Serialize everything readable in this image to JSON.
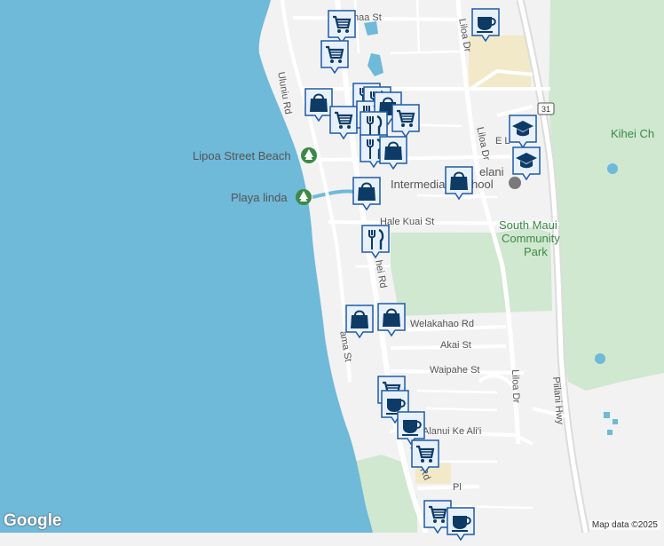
{
  "map": {
    "colors": {
      "land": "#f2f2f2",
      "water": "#6fb9d9",
      "park": "#cfe8cf",
      "road": "#ffffff",
      "highway": "#dcdcdc",
      "marker_fill": "#e8f1fb",
      "marker_border": "#1e5aa6",
      "marker_icon": "#0d3b66"
    },
    "labels": {
      "lipoa_beach": "Lipoa Street Beach",
      "playa_linda": "Playa linda",
      "school": "Intermediate School",
      "school_top": "elani",
      "park_name_1": "South Maui",
      "park_name_2": "Community",
      "park_name_3": "Park",
      "kihei_ch": "Kihei Ch"
    },
    "streets": {
      "haa_st": "haa St",
      "uluniu_rd": "Uluniu Rd",
      "liloa_dr_top": "Liloa Dr",
      "liloa_dr_mid": "Liloa Dr",
      "liloa_dr_bottom": "Liloa Dr",
      "hale_kuai": "Hale Kuai St",
      "kihei_rd_upper": "hei Rd",
      "welakahao": "Welakahao Rd",
      "akai": "Akai St",
      "waipahe": "Waipahe St",
      "alanui": "Alanui Ke Ali'i",
      "ama_st": "ama St",
      "kihei_rd_lower": "Kihei Rd",
      "piilani_hwy": "Piilani Hwy",
      "e_l": "E L",
      "pl": "Pl",
      "hwy_shield": "31"
    },
    "markers": [
      {
        "type": "shopping-cart"
      },
      {
        "type": "shopping-cart"
      },
      {
        "type": "coffee-cup"
      },
      {
        "type": "shopping-bag"
      },
      {
        "type": "restaurant"
      },
      {
        "type": "restaurant"
      },
      {
        "type": "shopping-cart"
      },
      {
        "type": "restaurant"
      },
      {
        "type": "shopping-bag"
      },
      {
        "type": "shopping-cart"
      },
      {
        "type": "restaurant"
      },
      {
        "type": "restaurant"
      },
      {
        "type": "shopping-bag"
      },
      {
        "type": "school-cap"
      },
      {
        "type": "school-cap"
      },
      {
        "type": "shopping-bag"
      },
      {
        "type": "shopping-bag"
      },
      {
        "type": "restaurant"
      },
      {
        "type": "shopping-bag"
      },
      {
        "type": "shopping-bag"
      },
      {
        "type": "shopping-cart"
      },
      {
        "type": "coffee-cup"
      },
      {
        "type": "coffee-cup"
      },
      {
        "type": "shopping-cart"
      },
      {
        "type": "shopping-cart"
      },
      {
        "type": "coffee-cup"
      }
    ],
    "logo": "Google",
    "attribution": "Map data ©2025"
  }
}
